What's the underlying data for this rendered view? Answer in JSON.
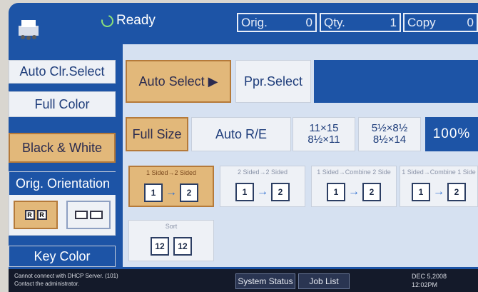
{
  "status": {
    "state_label": "Ready",
    "orig_label": "Orig.",
    "orig_value": "0",
    "qty_label": "Qty.",
    "qty_value": "1",
    "copy_label": "Copy",
    "copy_value": "0"
  },
  "color_mode": {
    "auto_label": "Auto Clr.Select",
    "full_label": "Full Color",
    "bw_label": "Black & White",
    "selected": "Black & White"
  },
  "paper": {
    "auto_select_label": "Auto Select ▶",
    "ppr_select_label": "Ppr.Select"
  },
  "reduce_enlarge": {
    "full_size_label": "Full Size",
    "auto_re_label": "Auto R/E",
    "preset1_top": "11×15",
    "preset1_bottom": "8½×11",
    "preset2_top": "5½×8½",
    "preset2_bottom": "8½×14",
    "ratio": "100%"
  },
  "orientation": {
    "title": "Orig. Orientation",
    "option1_glyph": "R",
    "option2_glyph": "▭"
  },
  "key_color_label": "Key Color",
  "duplex": [
    {
      "caption": "1 Sided→2 Sided",
      "page_a": "1",
      "page_b": "2",
      "selected": true
    },
    {
      "caption": "2 Sided→2 Sided",
      "page_a": "1",
      "page_b": "2",
      "selected": false
    },
    {
      "caption": "1 Sided→Combine 2 Side",
      "page_a": "1",
      "page_b": "2",
      "selected": false
    },
    {
      "caption": "1 Sided→Combine 1 Side",
      "page_a": "1",
      "page_b": "2",
      "selected": false
    }
  ],
  "sort": {
    "caption": "Sort"
  },
  "statusbar": {
    "message_line1": "Cannot connect with DHCP Server. (101)",
    "message_line2": "Contact the administrator.",
    "system_status_label": "System Status",
    "job_list_label": "Job List",
    "date": "DEC  5,2008",
    "time": "12:02PM"
  },
  "colors": {
    "panel_blue": "#1d54a6",
    "selected_tan": "#e2b87a",
    "button_face": "#eef1f6"
  }
}
